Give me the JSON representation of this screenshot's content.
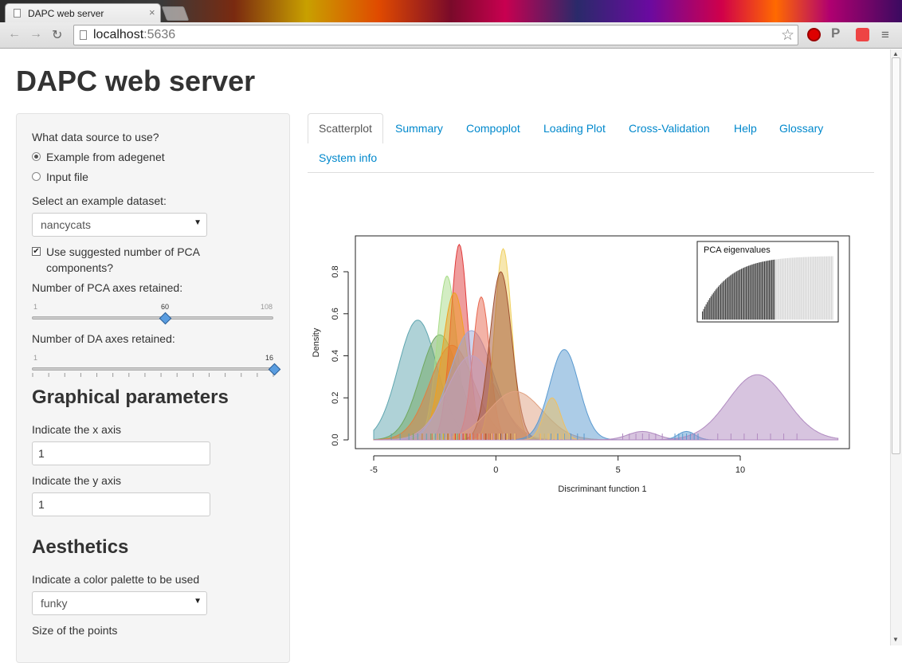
{
  "browser": {
    "tab_title": "DAPC web server",
    "tab_close": "×",
    "url_host": "localhost",
    "url_port": ":5636",
    "back": "←",
    "forward": "→",
    "reload": "↻",
    "star": "☆",
    "menu": "≡"
  },
  "page": {
    "title": "DAPC web server"
  },
  "sidebar": {
    "source_label": "What data source to use?",
    "radio_example": "Example from adegenet",
    "radio_input": "Input file",
    "dataset_label": "Select an example dataset:",
    "dataset_value": "nancycats",
    "suggest_pca_line1": "Use suggested number of PCA",
    "suggest_pca_line2": "components?",
    "pca_axes_label": "Number of PCA axes retained:",
    "pca_slider": {
      "min": "1",
      "max": "108",
      "value": "60"
    },
    "da_axes_label": "Number of DA axes retained:",
    "da_slider": {
      "min": "1",
      "max": "16",
      "value": "16"
    },
    "graphical_heading": "Graphical parameters",
    "x_axis_label": "Indicate the x axis",
    "x_axis_value": "1",
    "y_axis_label": "Indicate the y axis",
    "y_axis_value": "1",
    "aesthetics_heading": "Aesthetics",
    "palette_label": "Indicate a color palette to be used",
    "palette_value": "funky",
    "point_size_label": "Size of the points"
  },
  "tabs": [
    "Scatterplot",
    "Summary",
    "Compoplot",
    "Loading Plot",
    "Cross-Validation",
    "Help",
    "Glossary",
    "System info"
  ],
  "active_tab": "Scatterplot",
  "chart_data": {
    "type": "area",
    "title": "",
    "xlabel": "Discriminant function 1",
    "ylabel": "Density",
    "xlim": [
      -5,
      14
    ],
    "ylim": [
      0,
      0.95
    ],
    "xticks": [
      "-5",
      "0",
      "5",
      "10"
    ],
    "yticks": [
      "0.0",
      "0.2",
      "0.4",
      "0.6",
      "0.8"
    ],
    "inset_title": "PCA eigenvalues",
    "series": [
      {
        "mean": -3.2,
        "sd": 0.8,
        "peak": 0.57,
        "color": "#5fa6b0"
      },
      {
        "mean": -2.3,
        "sd": 0.8,
        "peak": 0.5,
        "color": "#70a860"
      },
      {
        "mean": -2.0,
        "sd": 0.4,
        "peak": 0.78,
        "color": "#a8dc88"
      },
      {
        "mean": -1.8,
        "sd": 0.9,
        "peak": 0.45,
        "color": "#e08040"
      },
      {
        "mean": -1.5,
        "sd": 0.35,
        "peak": 0.93,
        "color": "#e03c3c"
      },
      {
        "mean": -1.7,
        "sd": 0.5,
        "peak": 0.7,
        "color": "#f0a020"
      },
      {
        "mean": -1.0,
        "sd": 0.9,
        "peak": 0.52,
        "color": "#9aa8d8"
      },
      {
        "mean": -0.6,
        "sd": 0.35,
        "peak": 0.68,
        "color": "#e86850"
      },
      {
        "mean": -1.0,
        "sd": 1.0,
        "peak": 0.4,
        "color": "#c0a0c0"
      },
      {
        "mean": 0.3,
        "sd": 0.35,
        "peak": 0.91,
        "color": "#f0d060"
      },
      {
        "mean": 0.2,
        "sd": 0.45,
        "peak": 0.8,
        "color": "#a05030"
      },
      {
        "mean": 0.8,
        "sd": 1.1,
        "peak": 0.23,
        "color": "#e0a080"
      },
      {
        "mean": 2.8,
        "sd": 0.6,
        "peak": 0.43,
        "color": "#5a9ad0"
      },
      {
        "mean": 2.3,
        "sd": 0.35,
        "peak": 0.2,
        "color": "#f0c060"
      },
      {
        "mean": 6.0,
        "sd": 0.6,
        "peak": 0.04,
        "color": "#b08ac0"
      },
      {
        "mean": 7.8,
        "sd": 0.35,
        "peak": 0.04,
        "color": "#5a9ad0"
      },
      {
        "mean": 10.7,
        "sd": 1.2,
        "peak": 0.31,
        "color": "#b08ac0"
      }
    ]
  }
}
